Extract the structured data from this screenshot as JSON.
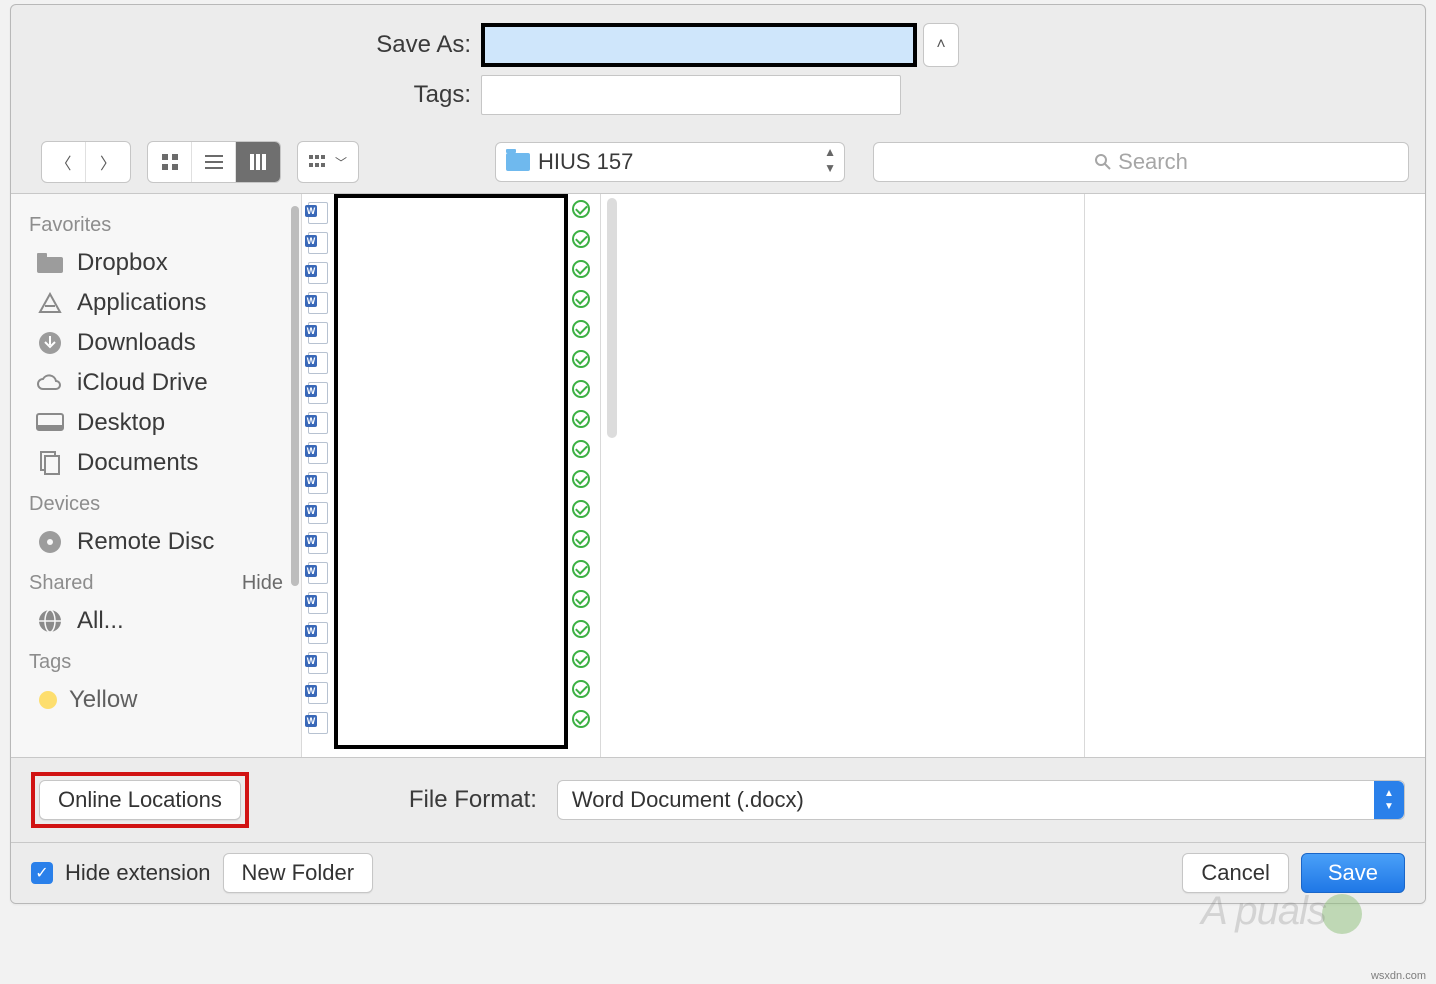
{
  "top": {
    "save_as_label": "Save As:",
    "save_as_value": "",
    "tags_label": "Tags:",
    "tags_value": ""
  },
  "toolbar": {
    "path_folder": "HIUS 157",
    "search_placeholder": "Search"
  },
  "sidebar": {
    "sections": {
      "favorites": {
        "header": "Favorites",
        "items": [
          "Dropbox",
          "Applications",
          "Downloads",
          "iCloud Drive",
          "Desktop",
          "Documents"
        ]
      },
      "devices": {
        "header": "Devices",
        "items": [
          "Remote Disc"
        ]
      },
      "shared": {
        "header": "Shared",
        "hide_label": "Hide",
        "items": [
          "All..."
        ]
      },
      "tags": {
        "header": "Tags",
        "items": [
          "Yellow"
        ]
      }
    }
  },
  "format": {
    "online_locations_label": "Online Locations",
    "file_format_label": "File Format:",
    "file_format_value": "Word Document (.docx)"
  },
  "bottom": {
    "hide_extension_label": "Hide extension",
    "hide_extension_checked": true,
    "new_folder_label": "New Folder",
    "cancel_label": "Cancel",
    "save_label": "Save"
  },
  "watermark": "A  puals",
  "source_text": "wsxdn.com"
}
